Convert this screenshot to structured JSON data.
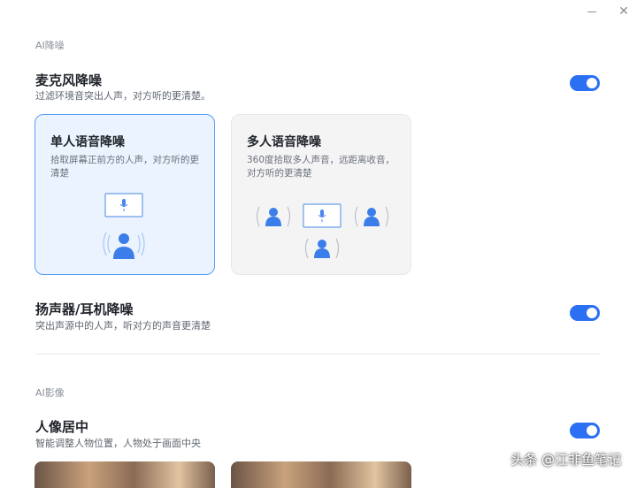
{
  "window": {
    "minimize_icon": "minimize-icon",
    "close_icon": "close-icon",
    "close_glyph": "✕"
  },
  "ai_noise": {
    "section_label": "AI降噪",
    "mic": {
      "title": "麦克风降噪",
      "desc": "过滤环境音突出人声，对方听的更清楚。",
      "enabled": true
    },
    "modes": [
      {
        "title": "单人语音降噪",
        "desc": "拾取屏幕正前方的人声，对方听的更清楚",
        "selected": true
      },
      {
        "title": "多人语音降噪",
        "desc": "360度拾取多人声音，远距离收音，对方听的更清楚",
        "selected": false
      }
    ],
    "speaker": {
      "title": "扬声器/耳机降噪",
      "desc": "突出声源中的人声，听对方的声音更清楚",
      "enabled": true
    }
  },
  "ai_image": {
    "section_label": "AI影像",
    "portrait": {
      "title": "人像居中",
      "desc": "智能调整人物位置，人物处于画面中央",
      "enabled": true
    }
  },
  "watermark": "头条 @江非鱼笔记",
  "colors": {
    "accent": "#2b6ff2",
    "selected_card_bg": "#eaf3fe",
    "selected_card_border": "#5a9ff5",
    "person_icon": "#3b7de9"
  }
}
